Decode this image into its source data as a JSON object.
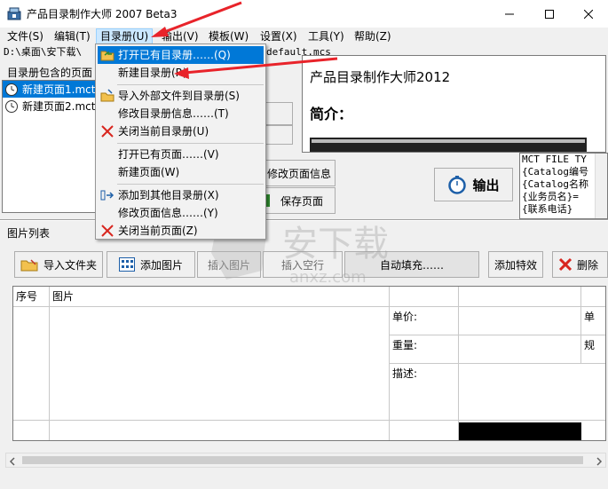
{
  "window": {
    "title": "产品目录制作大师 2007 Beta3"
  },
  "menubar": {
    "items": [
      {
        "label": "文件(S)"
      },
      {
        "label": "编辑(T)"
      },
      {
        "label": "目录册(U)"
      },
      {
        "label": "输出(V)"
      },
      {
        "label": "模板(W)"
      },
      {
        "label": "设置(X)"
      },
      {
        "label": "工具(Y)"
      },
      {
        "label": "帮助(Z)"
      }
    ]
  },
  "path_bar": {
    "text_left": "D:\\桌面\\安下载\\",
    "text_right": "default.mcs"
  },
  "left_panel": {
    "label": "目录册包含的页面",
    "files": [
      {
        "label": "新建页面1.mct"
      },
      {
        "label": "新建页面2.mct"
      }
    ]
  },
  "buttons": {
    "modify_page_info": "修改页面信息",
    "save_page": "保存页面",
    "output": "输出"
  },
  "preview": {
    "title": "产品目录制作大师2012",
    "intro": "简介："
  },
  "code_box": {
    "lines": [
      "MCT FILE TY",
      "{Catalog编号",
      "{Catalog名称",
      "{业务员名}=",
      "{联系电话}"
    ]
  },
  "picture_list": {
    "title": "图片列表",
    "toolbar": [
      {
        "label": "导入文件夹"
      },
      {
        "label": "添加图片"
      },
      {
        "label": "插入图片"
      },
      {
        "label": "插入空行"
      },
      {
        "label": "自动填充……"
      },
      {
        "label": "添加特效"
      },
      {
        "label": "删除"
      }
    ],
    "columns": {
      "index": "序号",
      "picture": "图片"
    },
    "fields": {
      "price": "单价:",
      "weight": "重量:",
      "desc": "描述:"
    },
    "right_partial": [
      "单",
      "规"
    ]
  },
  "dropdown": {
    "items": [
      {
        "label": "打开已有目录册……(Q)"
      },
      {
        "label": "新建目录册(R)"
      },
      {
        "label": "导入外部文件到目录册(S)"
      },
      {
        "label": "修改目录册信息……(T)"
      },
      {
        "label": "关闭当前目录册(U)"
      },
      {
        "label": "打开已有页面……(V)"
      },
      {
        "label": "新建页面(W)"
      },
      {
        "label": "添加到其他目录册(X)"
      },
      {
        "label": "修改页面信息……(Y)"
      },
      {
        "label": "关闭当前页面(Z)"
      }
    ]
  },
  "watermark": {
    "text": "安下载",
    "subtext": "anxz.com"
  },
  "colors": {
    "highlight": "#0078d7",
    "annotation_arrow": "#e8232a",
    "close_x": "#d8261f"
  }
}
